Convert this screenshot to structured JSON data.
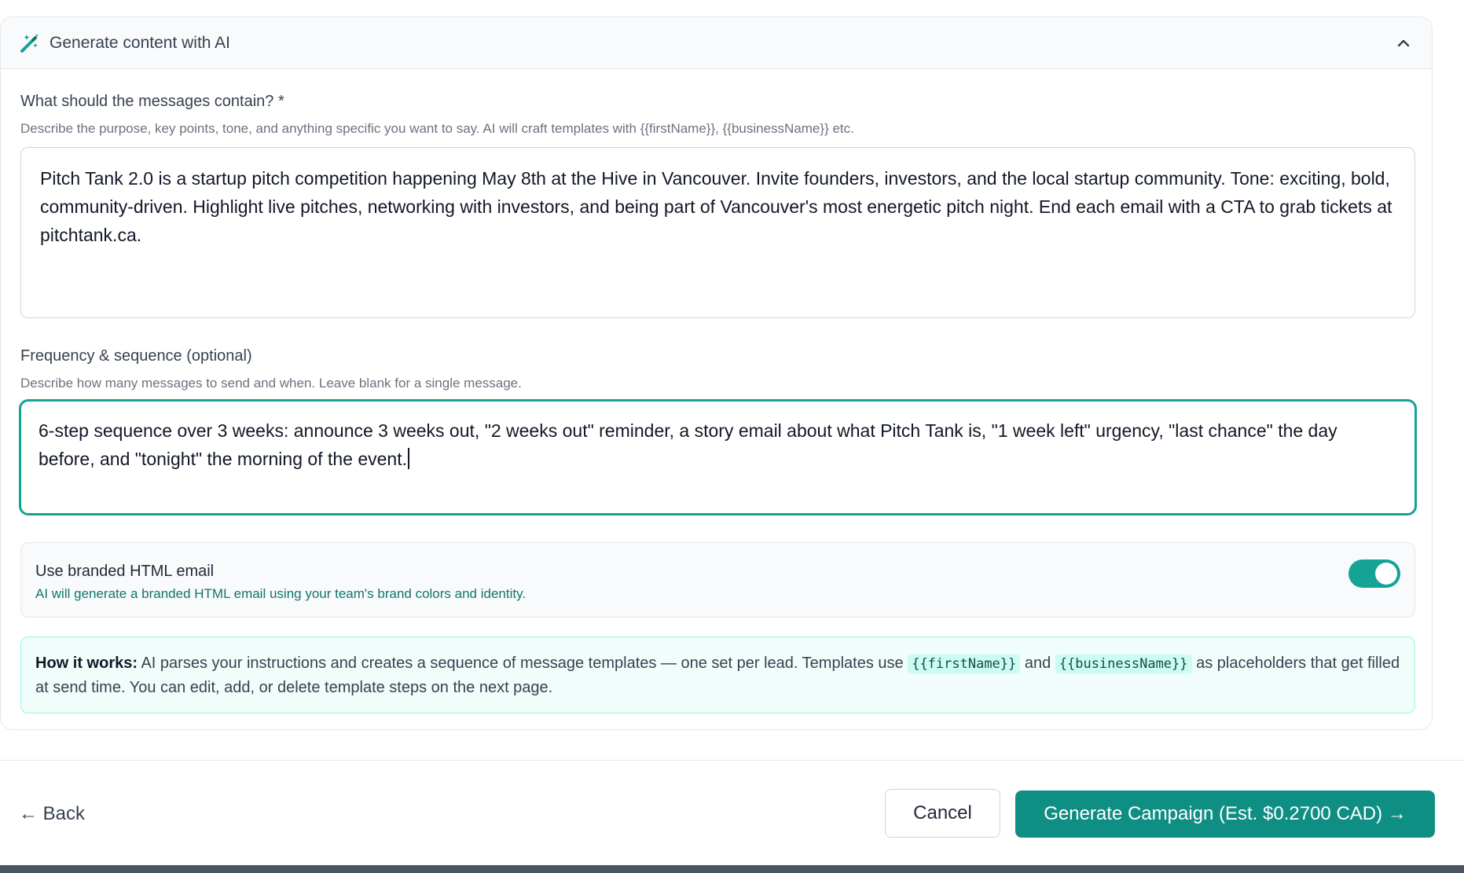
{
  "ai_panel": {
    "title": "Generate content with AI",
    "header_icon": "magic-wand-icon",
    "collapse_icon": "chevron-up-icon"
  },
  "content_field": {
    "label": "What should the messages contain? *",
    "help": "Describe the purpose, key points, tone, and anything specific you want to say. AI will craft templates with {{firstName}}, {{businessName}} etc.",
    "value": "Pitch Tank 2.0 is a startup pitch competition happening May 8th at the Hive in Vancouver. Invite founders, investors, and the local startup community. Tone: exciting, bold, community-driven. Highlight live pitches, networking with investors, and being part of Vancouver's most energetic pitch night. End each email with a CTA to grab tickets at pitchtank.ca."
  },
  "frequency_field": {
    "label": "Frequency & sequence (optional)",
    "help": "Describe how many messages to send and when. Leave blank for a single message.",
    "value": "6-step sequence over 3 weeks: announce 3 weeks out, \"2 weeks out\" reminder, a story email about what Pitch Tank is, \"1 week left\" urgency, \"last chance\" the day before, and \"tonight\" the morning of the event."
  },
  "branded_email": {
    "title": "Use branded HTML email",
    "description": "AI will generate a branded HTML email using your team's brand colors and identity.",
    "enabled": true
  },
  "how_it_works": {
    "heading": "How it works:",
    "text_1": " AI parses your instructions and creates a sequence of message templates — one set per lead. Templates use ",
    "code_1": "{{firstName}}",
    "text_2": " and ",
    "code_2": "{{businessName}}",
    "text_3": " as placeholders that get filled at send time. You can edit, add, or delete template steps on the next page."
  },
  "footer": {
    "back_label": "← Back",
    "cancel_label": "Cancel",
    "generate_label": "Generate Campaign (Est. $0.2700 CAD) →"
  },
  "colors": {
    "accent": "#14a394",
    "primary_button": "#0f8f84",
    "info_background": "#f0fdfa"
  }
}
